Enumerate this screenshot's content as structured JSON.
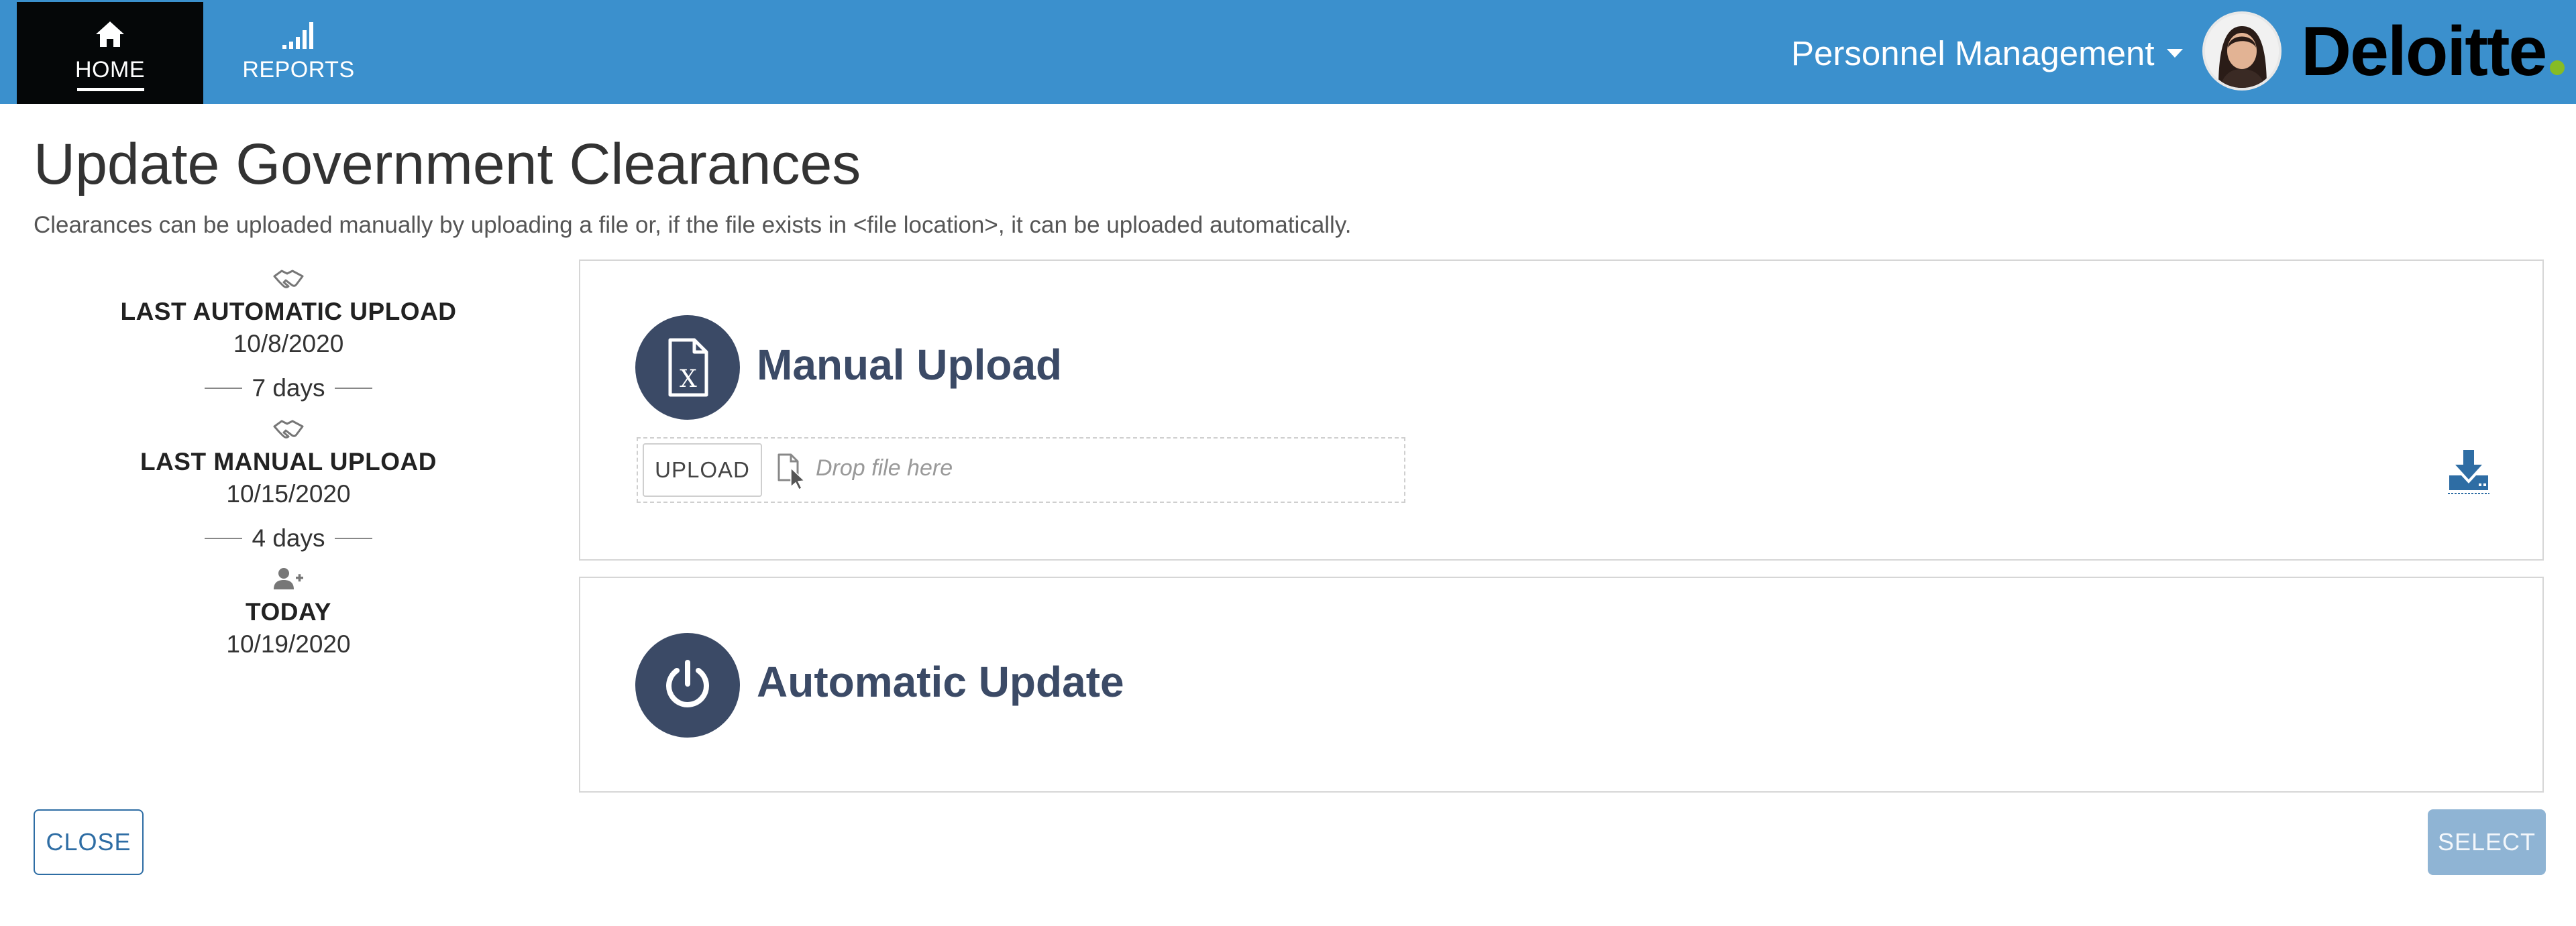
{
  "header": {
    "nav": [
      {
        "label": "HOME",
        "icon": "home-icon",
        "active": true
      },
      {
        "label": "REPORTS",
        "icon": "signal-bars-icon",
        "active": false
      }
    ],
    "module_selector": "Personnel Management",
    "logo_text": "Deloitte",
    "colors": {
      "bar": "#3b90cd",
      "active_tab": "#050708",
      "logo_dot": "#86bc25"
    }
  },
  "page": {
    "title": "Update Government Clearances",
    "subtitle": "Clearances can be uploaded manually by uploading a file or, if the file exists in <file location>, it can be uploaded automatically."
  },
  "timeline": {
    "items": [
      {
        "label": "LAST AUTOMATIC UPLOAD",
        "date": "10/8/2020",
        "icon": "handshake-icon"
      },
      {
        "label": "LAST MANUAL UPLOAD",
        "date": "10/15/2020",
        "icon": "handshake-icon"
      },
      {
        "label": "TODAY",
        "date": "10/19/2020",
        "icon": "user-plus-icon"
      }
    ],
    "gaps": [
      "7 days",
      "4 days"
    ]
  },
  "manual_upload": {
    "title": "Manual Upload",
    "icon": "excel-file-icon",
    "upload_button": "UPLOAD",
    "drop_placeholder": "Drop file here",
    "download_icon": "download-icon"
  },
  "automatic_update": {
    "title": "Automatic Update",
    "icon": "power-icon"
  },
  "footer": {
    "close_label": "CLOSE",
    "select_label": "SELECT",
    "select_enabled": false
  },
  "colors": {
    "accent_dark": "#3b4a66",
    "button_blue": "#2e6da4",
    "disabled_blue": "#8fb4d4"
  }
}
